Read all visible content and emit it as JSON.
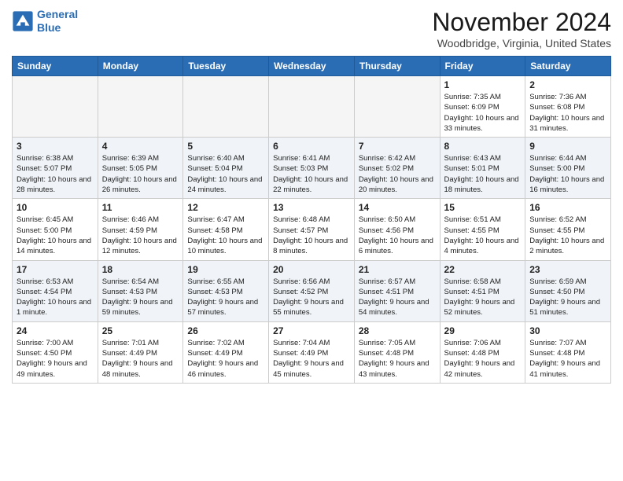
{
  "header": {
    "logo_line1": "General",
    "logo_line2": "Blue",
    "month": "November 2024",
    "location": "Woodbridge, Virginia, United States"
  },
  "days_of_week": [
    "Sunday",
    "Monday",
    "Tuesday",
    "Wednesday",
    "Thursday",
    "Friday",
    "Saturday"
  ],
  "weeks": [
    [
      {
        "day": "",
        "info": ""
      },
      {
        "day": "",
        "info": ""
      },
      {
        "day": "",
        "info": ""
      },
      {
        "day": "",
        "info": ""
      },
      {
        "day": "",
        "info": ""
      },
      {
        "day": "1",
        "info": "Sunrise: 7:35 AM\nSunset: 6:09 PM\nDaylight: 10 hours and 33 minutes."
      },
      {
        "day": "2",
        "info": "Sunrise: 7:36 AM\nSunset: 6:08 PM\nDaylight: 10 hours and 31 minutes."
      }
    ],
    [
      {
        "day": "3",
        "info": "Sunrise: 6:38 AM\nSunset: 5:07 PM\nDaylight: 10 hours and 28 minutes."
      },
      {
        "day": "4",
        "info": "Sunrise: 6:39 AM\nSunset: 5:05 PM\nDaylight: 10 hours and 26 minutes."
      },
      {
        "day": "5",
        "info": "Sunrise: 6:40 AM\nSunset: 5:04 PM\nDaylight: 10 hours and 24 minutes."
      },
      {
        "day": "6",
        "info": "Sunrise: 6:41 AM\nSunset: 5:03 PM\nDaylight: 10 hours and 22 minutes."
      },
      {
        "day": "7",
        "info": "Sunrise: 6:42 AM\nSunset: 5:02 PM\nDaylight: 10 hours and 20 minutes."
      },
      {
        "day": "8",
        "info": "Sunrise: 6:43 AM\nSunset: 5:01 PM\nDaylight: 10 hours and 18 minutes."
      },
      {
        "day": "9",
        "info": "Sunrise: 6:44 AM\nSunset: 5:00 PM\nDaylight: 10 hours and 16 minutes."
      }
    ],
    [
      {
        "day": "10",
        "info": "Sunrise: 6:45 AM\nSunset: 5:00 PM\nDaylight: 10 hours and 14 minutes."
      },
      {
        "day": "11",
        "info": "Sunrise: 6:46 AM\nSunset: 4:59 PM\nDaylight: 10 hours and 12 minutes."
      },
      {
        "day": "12",
        "info": "Sunrise: 6:47 AM\nSunset: 4:58 PM\nDaylight: 10 hours and 10 minutes."
      },
      {
        "day": "13",
        "info": "Sunrise: 6:48 AM\nSunset: 4:57 PM\nDaylight: 10 hours and 8 minutes."
      },
      {
        "day": "14",
        "info": "Sunrise: 6:50 AM\nSunset: 4:56 PM\nDaylight: 10 hours and 6 minutes."
      },
      {
        "day": "15",
        "info": "Sunrise: 6:51 AM\nSunset: 4:55 PM\nDaylight: 10 hours and 4 minutes."
      },
      {
        "day": "16",
        "info": "Sunrise: 6:52 AM\nSunset: 4:55 PM\nDaylight: 10 hours and 2 minutes."
      }
    ],
    [
      {
        "day": "17",
        "info": "Sunrise: 6:53 AM\nSunset: 4:54 PM\nDaylight: 10 hours and 1 minute."
      },
      {
        "day": "18",
        "info": "Sunrise: 6:54 AM\nSunset: 4:53 PM\nDaylight: 9 hours and 59 minutes."
      },
      {
        "day": "19",
        "info": "Sunrise: 6:55 AM\nSunset: 4:53 PM\nDaylight: 9 hours and 57 minutes."
      },
      {
        "day": "20",
        "info": "Sunrise: 6:56 AM\nSunset: 4:52 PM\nDaylight: 9 hours and 55 minutes."
      },
      {
        "day": "21",
        "info": "Sunrise: 6:57 AM\nSunset: 4:51 PM\nDaylight: 9 hours and 54 minutes."
      },
      {
        "day": "22",
        "info": "Sunrise: 6:58 AM\nSunset: 4:51 PM\nDaylight: 9 hours and 52 minutes."
      },
      {
        "day": "23",
        "info": "Sunrise: 6:59 AM\nSunset: 4:50 PM\nDaylight: 9 hours and 51 minutes."
      }
    ],
    [
      {
        "day": "24",
        "info": "Sunrise: 7:00 AM\nSunset: 4:50 PM\nDaylight: 9 hours and 49 minutes."
      },
      {
        "day": "25",
        "info": "Sunrise: 7:01 AM\nSunset: 4:49 PM\nDaylight: 9 hours and 48 minutes."
      },
      {
        "day": "26",
        "info": "Sunrise: 7:02 AM\nSunset: 4:49 PM\nDaylight: 9 hours and 46 minutes."
      },
      {
        "day": "27",
        "info": "Sunrise: 7:04 AM\nSunset: 4:49 PM\nDaylight: 9 hours and 45 minutes."
      },
      {
        "day": "28",
        "info": "Sunrise: 7:05 AM\nSunset: 4:48 PM\nDaylight: 9 hours and 43 minutes."
      },
      {
        "day": "29",
        "info": "Sunrise: 7:06 AM\nSunset: 4:48 PM\nDaylight: 9 hours and 42 minutes."
      },
      {
        "day": "30",
        "info": "Sunrise: 7:07 AM\nSunset: 4:48 PM\nDaylight: 9 hours and 41 minutes."
      }
    ]
  ]
}
